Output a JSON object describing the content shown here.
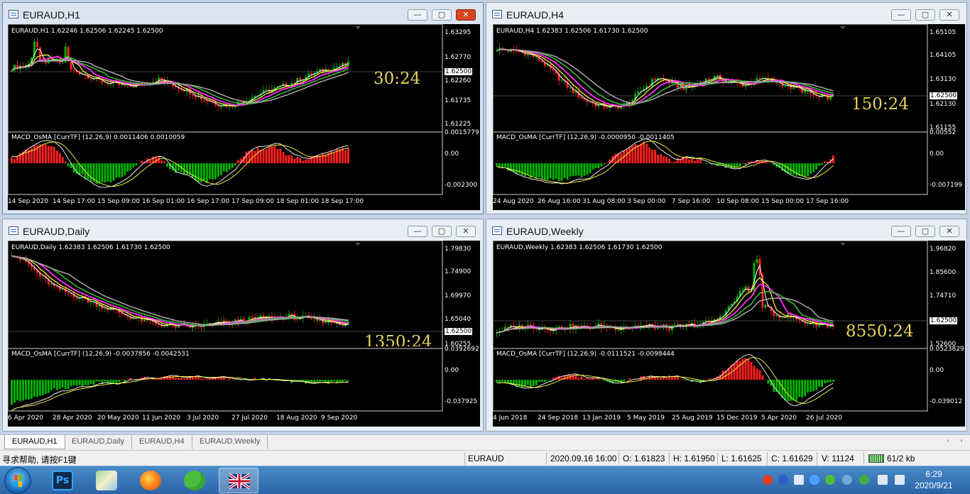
{
  "windows": [
    {
      "title": "EURAUD,H1",
      "info": "EURAUD,H1  1.62246 1.62506 1.62245 1.62500",
      "y_ticks": [
        "1.63295",
        "1.62770",
        "1.62500",
        "1.62260",
        "1.61735",
        "1.61225"
      ],
      "macd_label": "MACD_OsMA [CurrTF] (12,26,9) 0.0011406 0.0010059",
      "macd_ticks": [
        "0.0015779",
        "0.00",
        "-0.002300"
      ],
      "x_ticks": [
        "14 Sep 2020",
        "14 Sep 17:00",
        "15 Sep 09:00",
        "16 Sep 01:00",
        "16 Sep 17:00",
        "17 Sep 09:00",
        "18 Sep 01:00",
        "18 Sep 17:00"
      ],
      "timer": "30:24"
    },
    {
      "title": "EURAUD,H4",
      "info": "EURAUD,H4  1.62383 1.62506 1.61730 1.62500",
      "y_ticks": [
        "1.65105",
        "1.64105",
        "1.63130",
        "1.62500",
        "1.62130",
        "1.61155"
      ],
      "macd_label": "MACD_OsMA [CurrTF] (12,26,9) -0.0000950 -0.0011405",
      "macd_ticks": [
        "0.00552",
        "0.00",
        "-0.007199"
      ],
      "x_ticks": [
        "24 Aug 2020",
        "26 Aug 16:00",
        "31 Aug 08:00",
        "3 Sep 00:00",
        "7 Sep 16:00",
        "10 Sep 08:00",
        "15 Sep 00:00",
        "17 Sep 16:00"
      ],
      "timer": "150:24"
    },
    {
      "title": "EURAUD,Daily",
      "info": "EURAUD,Daily  1.62383 1.62506 1.61730 1.62500",
      "y_ticks": [
        "1.79830",
        "1.74900",
        "1.69970",
        "1.65040",
        "1.62500",
        "1.60255"
      ],
      "macd_label": "MACD_OsMA [CurrTF] (12,26,9) -0.0037856 -0.0042531",
      "macd_ticks": [
        "0.0392692",
        "0.00",
        "-0.037925"
      ],
      "x_ticks": [
        "6 Apr 2020",
        "28 Apr 2020",
        "20 May 2020",
        "11 Jun 2020",
        "3 Jul 2020",
        "27 Jul 2020",
        "18 Aug 2020",
        "9 Sep 2020"
      ],
      "timer": "1350:24"
    },
    {
      "title": "EURAUD,Weekly",
      "info": "EURAUD,Weekly  1.62383 1.62506 1.61730 1.62500",
      "y_ticks": [
        "1.96820",
        "1.85600",
        "1.74710",
        "1.62500",
        "1.52600"
      ],
      "macd_label": "MACD_OsMA [CurrTF] (12,26,9) -0.0111521 -0.0098444",
      "macd_ticks": [
        "0.0523829",
        "0.00",
        "-0.039012"
      ],
      "x_ticks": [
        "4 Jun 2018",
        "24 Sep 2018",
        "13 Jan 2019",
        "5 May 2019",
        "25 Aug 2019",
        "15 Dec 2019",
        "5 Apr 2020",
        "26 Jul 2020"
      ],
      "timer": "8550:24"
    }
  ],
  "window_buttons": {
    "minimize": "—",
    "maximize": "▢",
    "close": "✕"
  },
  "tabs": [
    "EURAUD,H1",
    "EURAUD,Daily",
    "EURAUD,H4",
    "EURAUD,Weekly"
  ],
  "tab_arrows": [
    "‹",
    "›"
  ],
  "status": {
    "help": "寻求帮助, 请按F1键",
    "symbol": "EURAUD",
    "datetime": "2020.09.16 16:00",
    "open": "O: 1.61823",
    "high": "H: 1.61950",
    "low": "L: 1.61625",
    "close": "C: 1.61629",
    "volume": "V: 11124",
    "traffic": "61/2 kb"
  },
  "taskbar": {
    "apps": [
      "windows-start",
      "photoshop",
      "maps",
      "firefox",
      "wechat",
      "uk-flag-app"
    ],
    "ps_label": "Ps",
    "time": "6:29",
    "date": "2020/9/21"
  },
  "colors": {
    "bull": "#00b000",
    "bear": "#ff2020",
    "ma_white": "#ffffff",
    "ma_yellow": "#ffff40",
    "ma_magenta": "#ff30ff",
    "ma_green": "#40c040",
    "ma_gray": "#a8a8a8",
    "timer": "#e6d45a"
  }
}
